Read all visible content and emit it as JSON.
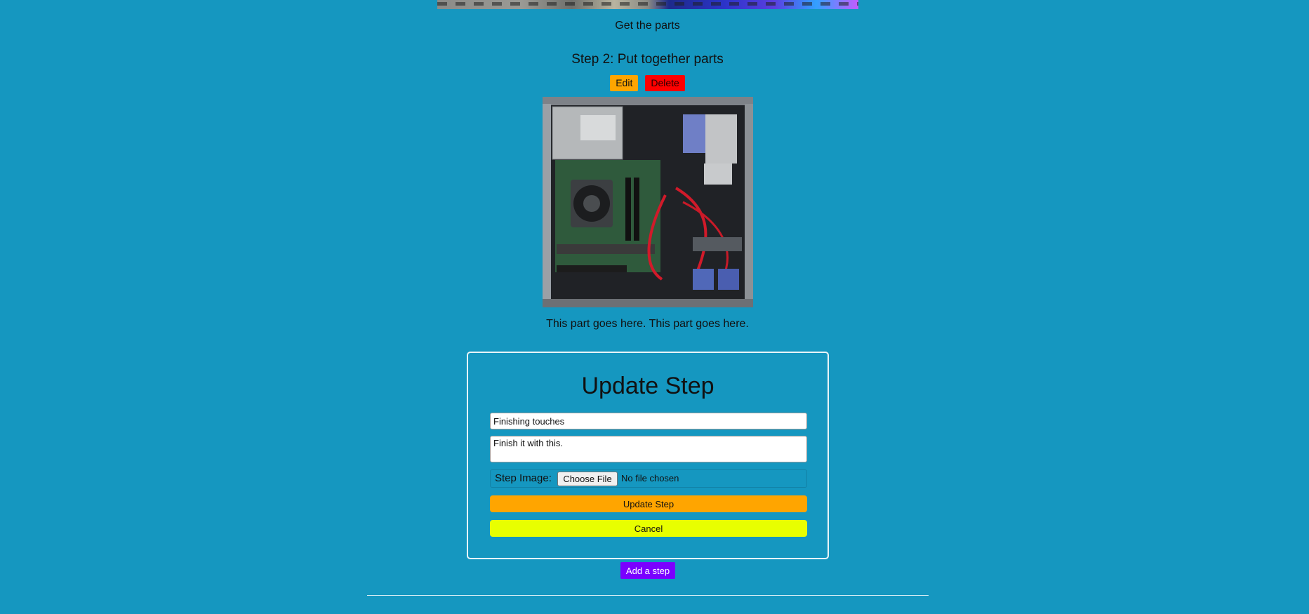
{
  "previous_step": {
    "caption": "Get the parts"
  },
  "step": {
    "title": "Step 2: Put together parts",
    "edit_label": "Edit",
    "delete_label": "Delete",
    "description": "This part goes here. This part goes here."
  },
  "update_form": {
    "heading": "Update Step",
    "title_value": "Finishing touches",
    "description_value": "Finish it with this.",
    "image_label": "Step Image:",
    "choose_file_label": "Choose File",
    "file_status": "No file chosen",
    "submit_label": "Update Step",
    "cancel_label": "Cancel"
  },
  "add_step_label": "Add a step",
  "colors": {
    "background": "#1597c0",
    "edit": "#ffa500",
    "delete": "#ff0000",
    "update": "#ffa500",
    "cancel": "#e8ff00",
    "add_step": "#7a00ff"
  }
}
